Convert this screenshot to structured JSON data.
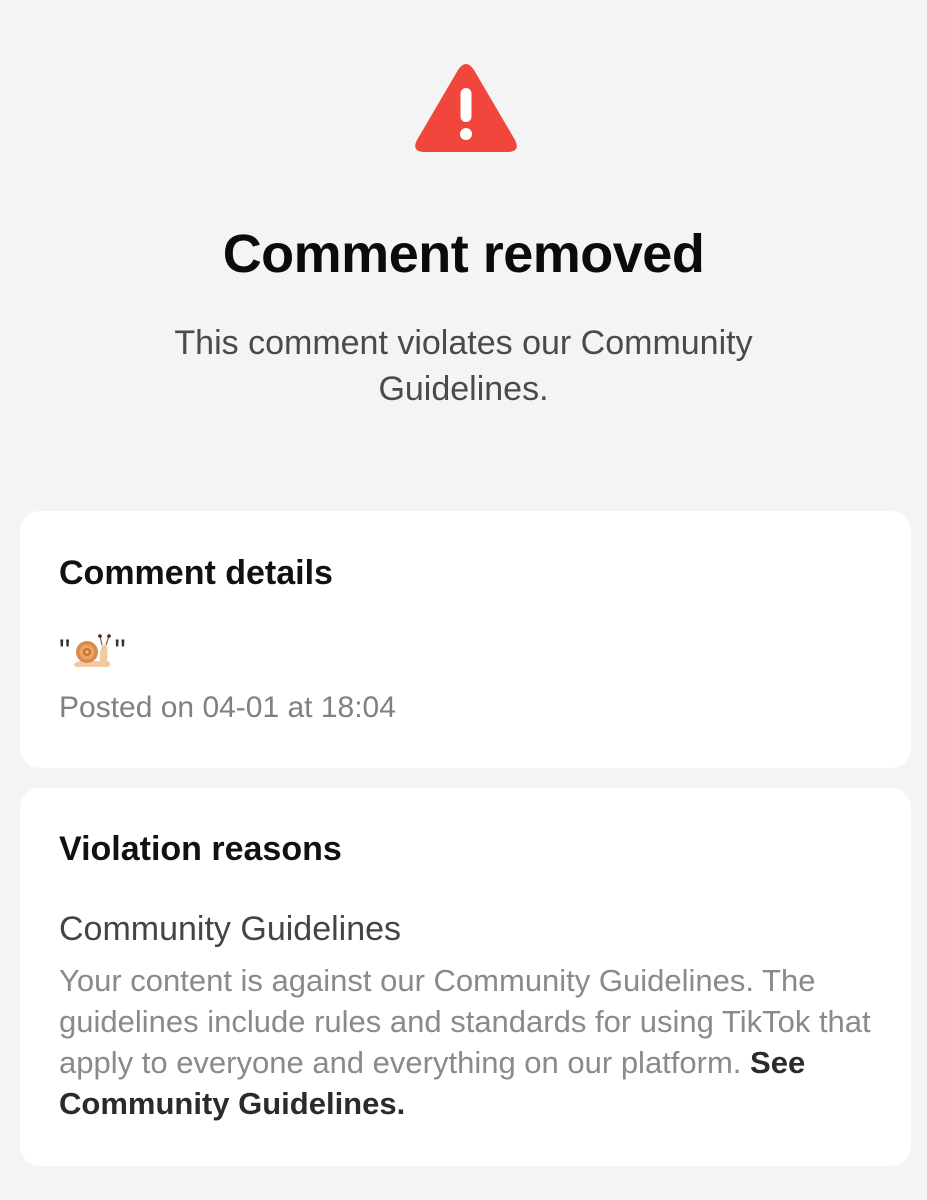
{
  "header": {
    "icon": "warning-triangle-icon",
    "icon_color": "#f0463c",
    "title": "Comment removed",
    "subtitle": "This comment violates our Community Guidelines."
  },
  "comment_details": {
    "heading": "Comment details",
    "quote_open": "\"",
    "comment_icon": "snail-icon",
    "quote_close": "\"",
    "posted_on": "Posted on 04-01 at 18:04"
  },
  "violation_reasons": {
    "heading": "Violation reasons",
    "reason_title": "Community Guidelines",
    "reason_description": "Your content is against our Community Guidelines. The guidelines include rules and standards for using TikTok that apply to everyone and everything on our platform.",
    "link_label": "See Community Guidelines."
  }
}
